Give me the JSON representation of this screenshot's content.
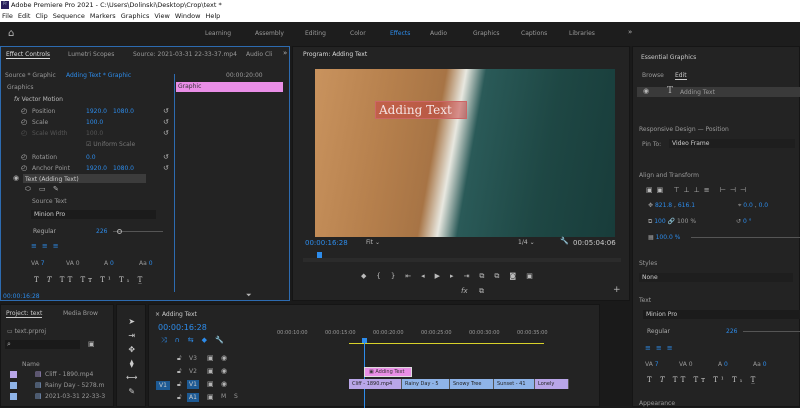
{
  "window": {
    "title": "Adobe Premiere Pro 2021 - C:\\Users\\Dolinski\\Desktop\\Crop\\text *",
    "app_icon": "Pr"
  },
  "menu": [
    "File",
    "Edit",
    "Clip",
    "Sequence",
    "Markers",
    "Graphics",
    "View",
    "Window",
    "Help"
  ],
  "workspaces": [
    "Learning",
    "Assembly",
    "Editing",
    "Color",
    "Effects",
    "Audio",
    "Graphics",
    "Captions",
    "Libraries"
  ],
  "active_workspace": "Effects",
  "effect_controls": {
    "tabs": [
      "Effect Controls",
      "Lumetri Scopes",
      "Source: 2021-03-31 22-33-37.mp4",
      "Audio Cli"
    ],
    "source": "Source * Graphic",
    "sequence": "Adding Text * Graphic",
    "time_ruler": "00:00:20:00",
    "clip_label": "Graphic",
    "section": "Graphics",
    "vector_motion": "Vector Motion",
    "props": [
      {
        "name": "Position",
        "v1": "1920.0",
        "v2": "1080.0"
      },
      {
        "name": "Scale",
        "v1": "100.0",
        "v2": ""
      },
      {
        "name": "Scale Width",
        "v1": "100.0",
        "v2": ""
      },
      {
        "name": "Rotation",
        "v1": "0.0",
        "v2": ""
      },
      {
        "name": "Anchor Point",
        "v1": "1920.0",
        "v2": "1080.0"
      }
    ],
    "uniform_scale": "Uniform Scale",
    "uniform_checked": true,
    "text_layer": "Text (Adding Text)",
    "source_text": "Source Text",
    "font": "Minion Pro",
    "style": "Regular",
    "size": "226",
    "tracking": "7",
    "kerning": "0",
    "baseline": "0",
    "tsume": "0",
    "timecode": "00:00:16:28"
  },
  "program": {
    "title": "Program: Adding Text",
    "overlay_text": "Adding Text",
    "timecode": "00:00:16:28",
    "fit": "Fit",
    "resolution": "1/4",
    "duration": "00:05:04:06"
  },
  "essential_graphics": {
    "title": "Essential Graphics",
    "tabs": [
      "Browse",
      "Edit"
    ],
    "layer": "Adding Text",
    "responsive": "Responsive Design — Position",
    "pin_label": "Pin To:",
    "pin_value": "Video Frame",
    "align": "Align and Transform",
    "pos_x": "821.8",
    "pos_y": "616.1",
    "anchor_x": "0.0",
    "anchor_y": "0.0",
    "scale": "100",
    "scale2": "100",
    "pct": "%",
    "rotation": "0 °",
    "opacity": "100.0 %",
    "styles": "Styles",
    "style_value": "None",
    "text": "Text",
    "font": "Minion Pro",
    "font_style": "Regular",
    "size": "226",
    "tracking": "7",
    "kerning": "0",
    "baseline": "0",
    "tsume": "0",
    "appearance": "Appearance"
  },
  "project": {
    "tabs": [
      "Project: text",
      "Media Brow"
    ],
    "file": "text.prproj",
    "col_name": "Name",
    "items": [
      {
        "name": "Cliff - 1890.mp4",
        "color": "#b9a6e8"
      },
      {
        "name": "Rainy Day - 5278.m",
        "color": "#8fb4e8"
      },
      {
        "name": "2021-03-31 22-33-3",
        "color": "#8fb4e8"
      }
    ]
  },
  "timeline": {
    "title": "Adding Text",
    "timecode": "00:00:16:28",
    "ruler": [
      "00:00:10:00",
      "00:00:15:00",
      "00:00:20:00",
      "00:00:25:00",
      "00:00:30:00",
      "00:00:35:00"
    ],
    "tracks": [
      "V3",
      "V2",
      "V1",
      "A1"
    ],
    "source_patch": "V1",
    "mute": "M",
    "solo": "S",
    "graphic_clip": "Adding Text",
    "clips": [
      {
        "name": "Cliff - 1890.mp4",
        "color": "#b9a6e8"
      },
      {
        "name": "Rainy Day - 5",
        "color": "#8fb4e8"
      },
      {
        "name": "Snowy Tree",
        "color": "#8fb4e8"
      },
      {
        "name": "Sunset - 41",
        "color": "#8fb4e8"
      },
      {
        "name": "Lonely",
        "color": "#b9a6e8"
      }
    ]
  },
  "colors": {
    "accent": "#2d8ceb",
    "graphic_clip": "#e98ee6",
    "video_clip": "#8fb4e8",
    "work_area": "#d8d12a"
  }
}
